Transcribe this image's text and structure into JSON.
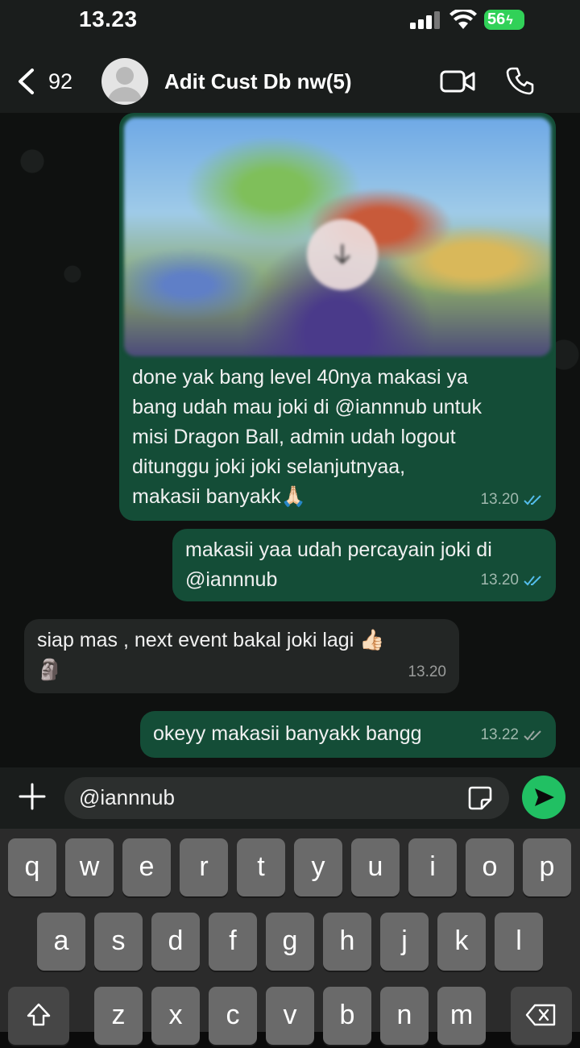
{
  "status_bar": {
    "time": "13.23",
    "battery": "56"
  },
  "header": {
    "back_count": "92",
    "contact_name": "Adit Cust Db nw(5)"
  },
  "messages": [
    {
      "text": "done yak bang level 40nya makasi ya\nbang udah mau joki di @iannnub untuk\nmisi Dragon Ball, admin udah logout\nditunggu joki joki selanjutnyaa,\nmakasii banyakk🙏🏻",
      "time": "13.20"
    },
    {
      "text": "makasii yaa udah percayain joki di\n@iannnub",
      "time": "13.20"
    },
    {
      "text": "siap mas , next event bakal joki lagi 👍🏻\n🗿",
      "time": "13.20"
    },
    {
      "text": "okeyy makasii banyakk bangg",
      "time": "13.22"
    }
  ],
  "composer": {
    "input_value": "@iannnub"
  },
  "keyboard": {
    "row1": [
      "q",
      "w",
      "e",
      "r",
      "t",
      "y",
      "u",
      "i",
      "o",
      "p"
    ],
    "row2": [
      "a",
      "s",
      "d",
      "f",
      "g",
      "h",
      "j",
      "k",
      "l"
    ],
    "row3": [
      "z",
      "x",
      "c",
      "v",
      "b",
      "n",
      "m"
    ]
  },
  "colors": {
    "outgoing_bubble": "#144d37",
    "incoming_bubble": "#232625",
    "send_button": "#21c063",
    "read_ticks": "#53bdeb",
    "battery": "#31d158"
  },
  "icons": [
    "back-chevron-icon",
    "avatar-placeholder-icon",
    "video-call-icon",
    "phone-icon",
    "download-icon",
    "plus-icon",
    "sticker-icon",
    "send-icon",
    "shift-icon",
    "delete-icon",
    "signal-icon",
    "wifi-icon",
    "battery-bolt-icon"
  ]
}
